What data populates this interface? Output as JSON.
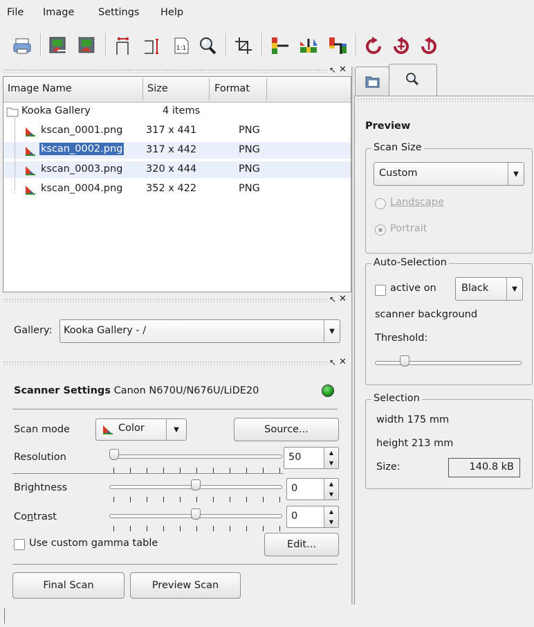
{
  "menu": [
    "File",
    "Image",
    "Settings",
    "Help"
  ],
  "toolbar_icons": [
    "print-icon",
    "image-save-icon",
    "image-delete-icon",
    "fit-width-icon",
    "fit-height-icon",
    "zoom-original-icon",
    "zoom-search-icon",
    "crop-icon",
    "mirror-vertical-icon",
    "mirror-horizontal-icon",
    "mirror-both-icon",
    "rotate-cw-icon",
    "rotate-ccw-icon",
    "rotate-180-icon"
  ],
  "gallery_table": {
    "headers": [
      "Image Name",
      "Size",
      "Format"
    ],
    "root": {
      "name": "Kooka Gallery",
      "size": "4 items"
    },
    "rows": [
      {
        "name": "kscan_0001.png",
        "size": "317 x 441",
        "format": "PNG"
      },
      {
        "name": "kscan_0002.png",
        "size": "317 x 442",
        "format": "PNG"
      },
      {
        "name": "kscan_0003.png",
        "size": "320 x 444",
        "format": "PNG"
      },
      {
        "name": "kscan_0004.png",
        "size": "352 x 422",
        "format": "PNG"
      }
    ]
  },
  "gallery_selector": {
    "label": "Gallery:",
    "value": "Kooka Gallery - /"
  },
  "scanner": {
    "title_bold": "Scanner Settings",
    "device": "Canon N670U/N676U/LiDE20",
    "status_color": "#1e9e1e",
    "scan_mode_label": "Scan mode",
    "scan_mode_value": "Color",
    "source_button": "Source...",
    "resolution_label": "Resolution",
    "resolution_value": "50",
    "brightness_label": "Brightness",
    "brightness_value": "0",
    "contrast_label": "Contrast",
    "contrast_value": "0",
    "gamma_label": "Use custom gamma table",
    "edit_button": "Edit...",
    "final_scan": "Final Scan",
    "preview_scan": "Preview Scan"
  },
  "preview_panel": {
    "heading": "Preview",
    "scan_size_title": "Scan Size",
    "scan_size_value": "Custom",
    "landscape": "Landscape",
    "portrait": "Portrait",
    "autosel_title": "Auto-Selection",
    "active_on": "active on",
    "bg_value": "Black",
    "scanner_background": "scanner background",
    "threshold": "Threshold:",
    "selection_title": "Selection",
    "width": "width 175 mm",
    "height": "height 213 mm",
    "size_label": "Size:",
    "size_value": "140.8 kB"
  },
  "colors": {
    "selection": "#3d6eb7",
    "row_alt": "#eaf0fb"
  }
}
